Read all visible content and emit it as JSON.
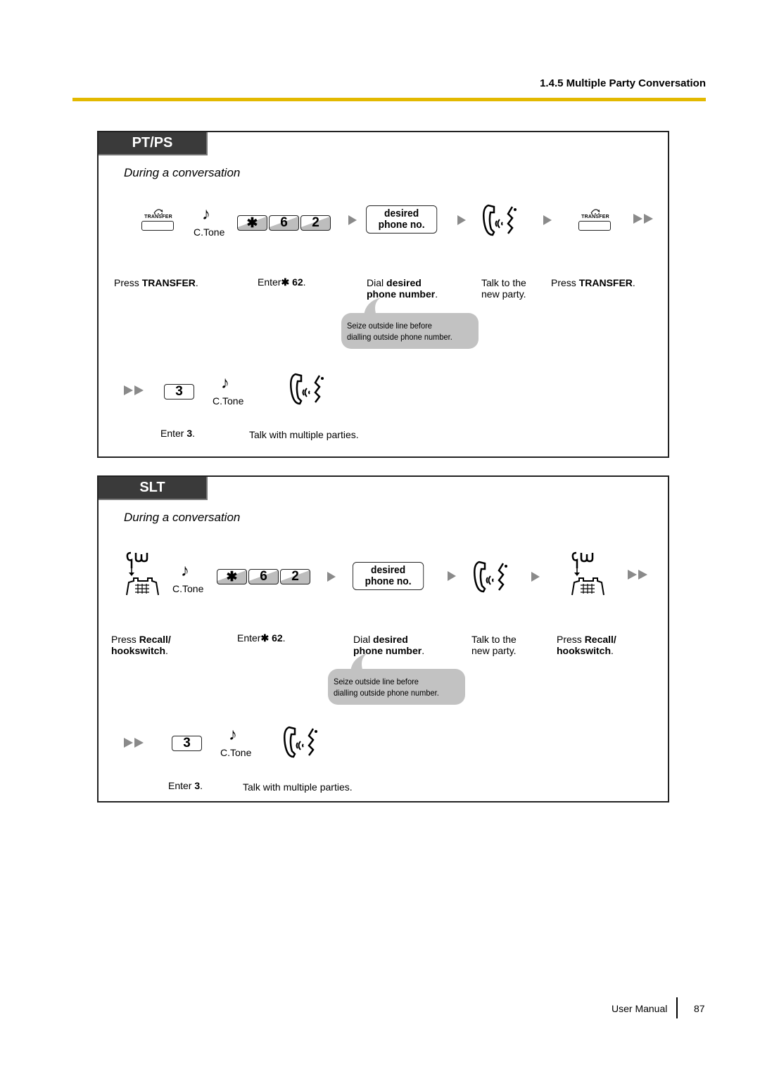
{
  "header": {
    "section_title": "1.4.5 Multiple Party Conversation"
  },
  "panels": [
    {
      "tab": "PT/PS",
      "context": "During a conversation",
      "row1": {
        "transfer_label": "TRANSFER",
        "ctone_label": "C.Tone",
        "keys": [
          "✱",
          "6",
          "2"
        ],
        "phone_box": [
          "desired",
          "phone no."
        ]
      },
      "steps": {
        "s1_pre": "Press ",
        "s1_bold": "TRANSFER",
        "s1_post": ".",
        "s2_pre": "Enter",
        "s2_bold": "✱ 62",
        "s2_post": ".",
        "s3_pre": "Dial ",
        "s3_bold1": "desired",
        "s3_bold2": "phone number",
        "s3_post": ".",
        "s4_line1": "Talk to the",
        "s4_line2": "new party.",
        "s5_pre": "Press ",
        "s5_bold": "TRANSFER",
        "s5_post": "."
      },
      "bubble": [
        "Seize outside line before",
        "dialling outside phone number."
      ],
      "row2": {
        "key": "3",
        "ctone_label": "C.Tone",
        "enter_pre": "Enter ",
        "enter_bold": "3",
        "enter_post": ".",
        "talk": "Talk with multiple parties."
      }
    },
    {
      "tab": "SLT",
      "context": "During a conversation",
      "row1": {
        "ctone_label": "C.Tone",
        "keys": [
          "✱",
          "6",
          "2"
        ],
        "phone_box": [
          "desired",
          "phone no."
        ]
      },
      "steps": {
        "s1_pre": "Press ",
        "s1_bold1": "Recall/",
        "s1_bold2": "hookswitch",
        "s1_post": ".",
        "s2_pre": "Enter",
        "s2_bold": "✱ 62",
        "s2_post": ".",
        "s3_pre": "Dial ",
        "s3_bold1": "desired",
        "s3_bold2": "phone number",
        "s3_post": ".",
        "s4_line1": "Talk to the",
        "s4_line2": "new party.",
        "s5_pre": "Press ",
        "s5_bold1": "Recall/",
        "s5_bold2": "hookswitch",
        "s5_post": "."
      },
      "bubble": [
        "Seize outside line before",
        "dialling outside phone number."
      ],
      "row2": {
        "key": "3",
        "ctone_label": "C.Tone",
        "enter_pre": "Enter ",
        "enter_bold": "3",
        "enter_post": ".",
        "talk": "Talk with multiple parties."
      }
    }
  ],
  "footer": {
    "label": "User Manual",
    "page": "87"
  },
  "colors": {
    "accent_rule": "#e3b900",
    "tab_bg": "#3a3a3a",
    "bubble_bg": "#c2c2c2",
    "arrow": "#8a8a8a"
  }
}
